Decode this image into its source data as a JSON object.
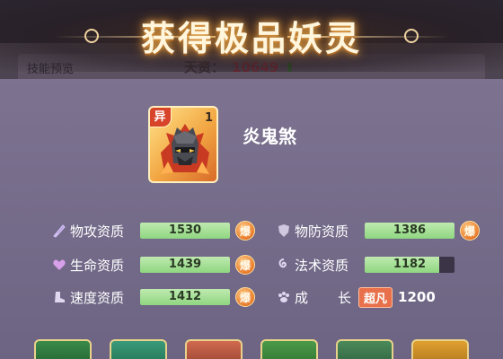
{
  "background": {
    "tab_label": "技能预览",
    "talent_label": "天资：",
    "talent_value": "10649",
    "talent_arrow": "⬆"
  },
  "dialog": {
    "title": "获得极品妖灵"
  },
  "character": {
    "name": "炎鬼煞",
    "badge": "异",
    "level": "1"
  },
  "stats": [
    {
      "label": "物攻资质",
      "value": "1530",
      "fill": 1.0,
      "burst": "爆"
    },
    {
      "label": "物防资质",
      "value": "1386",
      "fill": 1.0,
      "burst": "爆"
    },
    {
      "label": "生命资质",
      "value": "1439",
      "fill": 1.0,
      "burst": "爆"
    },
    {
      "label": "法术资质",
      "value": "1182",
      "fill": 0.83,
      "burst": ""
    },
    {
      "label": "速度资质",
      "value": "1412",
      "fill": 1.0,
      "burst": "爆"
    }
  ],
  "growth": {
    "label": "成　　长",
    "label_left": "成",
    "label_right": "长",
    "badge": "超凡",
    "value": "1200"
  },
  "colors": {
    "bar_fill": "#8fd680",
    "bar_empty": "#3b3446",
    "burst": "#e87a2a",
    "title_glow": "#e8a84c"
  }
}
